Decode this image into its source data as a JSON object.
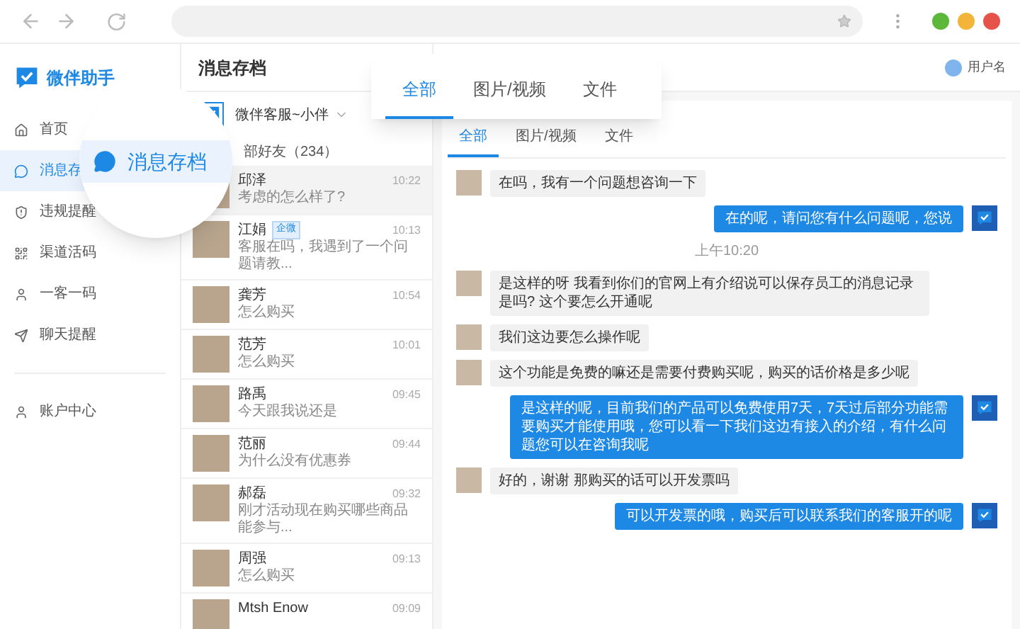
{
  "app": {
    "name": "微伴助手"
  },
  "sidebar": {
    "items": [
      {
        "kind": "home",
        "label": "首页",
        "selected": false
      },
      {
        "kind": "chat",
        "label": "消息存",
        "selected": true
      },
      {
        "kind": "alert",
        "label": "违规提醒",
        "selected": false
      },
      {
        "kind": "qr",
        "label": "渠道活码",
        "selected": false
      },
      {
        "kind": "user",
        "label": "一客一码",
        "selected": false
      },
      {
        "kind": "send",
        "label": "聊天提醒",
        "selected": false
      }
    ],
    "footer_items": [
      {
        "kind": "user",
        "label": "账户中心",
        "selected": false
      }
    ]
  },
  "magnifier": {
    "label": "消息存档"
  },
  "header": {
    "title": "消息存档",
    "user": "用户名"
  },
  "account": {
    "name": "微伴客服~小伴"
  },
  "friends_count": "部好友（234）",
  "contacts": [
    {
      "name": "邱泽",
      "time": "10:22",
      "preview": "考虑的怎么样了?",
      "selected": true
    },
    {
      "name": "江娟",
      "badge": "企微",
      "time": "10:13",
      "preview": "客服在吗，我遇到了一个问题请教...",
      "selected": false
    },
    {
      "name": "龚芳",
      "time": "10:54",
      "preview": "怎么购买",
      "selected": false
    },
    {
      "name": "范芳",
      "time": "10:01",
      "preview": "怎么购买",
      "selected": false
    },
    {
      "name": "路禹",
      "time": "09:45",
      "preview": "今天跟我说还是",
      "selected": false
    },
    {
      "name": "范丽",
      "time": "09:44",
      "preview": "为什么没有优惠券",
      "selected": false
    },
    {
      "name": "郝磊",
      "time": "09:32",
      "preview": "刚才活动现在购买哪些商品能参与...",
      "selected": false
    },
    {
      "name": "周强",
      "time": "09:13",
      "preview": "怎么购买",
      "selected": false
    },
    {
      "name": "Mtsh Enow",
      "time": "09:09",
      "selected": false
    }
  ],
  "tabs": [
    {
      "label": "全部",
      "selected": true
    },
    {
      "label": "图片/视频",
      "selected": false
    },
    {
      "label": "文件",
      "selected": false
    }
  ],
  "popup_tabs": [
    {
      "label": "全部",
      "selected": true
    },
    {
      "label": "图片/视频",
      "selected": false
    },
    {
      "label": "文件",
      "selected": false
    }
  ],
  "messages": [
    {
      "kind": "customer",
      "text": "在吗，我有一个问题想咨询一下"
    },
    {
      "kind": "agent",
      "text": "在的呢，请问您有什么问题呢，您说"
    },
    {
      "kind": "time",
      "text": "上午10:20"
    },
    {
      "kind": "customer",
      "text": "是这样的呀 我看到你们的官网上有介绍说可以保存员工的消息记录是吗? 这个要怎么开通呢"
    },
    {
      "kind": "customer",
      "text": "我们这边要怎么操作呢"
    },
    {
      "kind": "customer",
      "text": "这个功能是免费的嘛还是需要付费购买呢，购买的话价格是多少呢"
    },
    {
      "kind": "agent",
      "text": "是这样的呢，目前我们的产品可以免费使用7天，7天过后部分功能需要购买才能使用哦，您可以看一下我们这边有接入的介绍，有什么问题您可以在咨询我呢"
    },
    {
      "kind": "customer",
      "text": "好的，谢谢 那购买的话可以开发票吗"
    },
    {
      "kind": "agent",
      "text": "可以开发票的哦，购买后可以联系我们的客服开的呢"
    }
  ]
}
